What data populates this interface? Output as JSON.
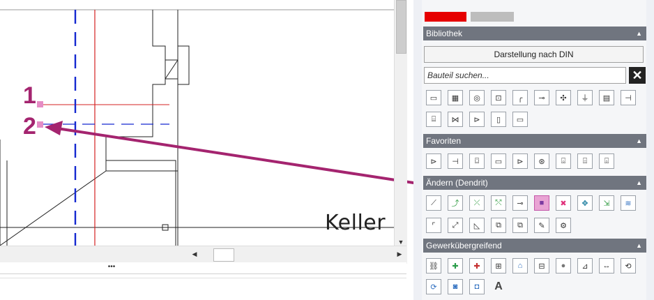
{
  "drawing": {
    "label": "Keller",
    "callouts": [
      "1",
      "2"
    ],
    "colors": {
      "red": "#d42020",
      "blue": "#1428d0",
      "arrow": "#a4246f",
      "marker": "#e58cc5"
    }
  },
  "panel": {
    "swatches": [
      "#e60000",
      "#bdbdbd"
    ],
    "sections": {
      "bibliothek": "Bibliothek",
      "favoriten": "Favoriten",
      "aendern": "Ändern (Dendrit)",
      "gewerk": "Gewerkübergreifend"
    },
    "din_button": "Darstellung nach DIN",
    "search_placeholder": "Bauteil suchen...",
    "search_close": "✕",
    "active_tool_index": 5,
    "tool_icons": {
      "bibliothek_row1": [
        "valve-box-icon",
        "hatch-icon",
        "circle-ring-icon",
        "pump-icon",
        "pipe-bend-icon",
        "circle-valve-icon",
        "star-valve-icon",
        "tank-icon",
        "radiator-icon",
        "connector-icon"
      ],
      "bibliothek_row2": [
        "boiler-icon",
        "double-valve-icon",
        "reducer-icon",
        "cylinder-icon",
        "rectangle-icon"
      ],
      "favoriten": [
        "reducer-icon",
        "connector-icon",
        "pipe-fitting-icon",
        "valve-box-icon",
        "reducer-icon",
        "gauge-icon",
        "heater-icon",
        "unit-icon",
        "unit-b-icon"
      ],
      "aendern_row1": [
        "line-edit-icon",
        "join-icon",
        "split-icon",
        "route-icon",
        "insert-icon",
        "move-object-icon",
        "delete-icon",
        "move-cross-icon",
        "adjust-icon",
        "parallel-icon"
      ],
      "aendern_row2": [
        "corner-icon",
        "extend-icon",
        "shape-icon",
        "copy-icon",
        "copy-multi-icon",
        "pencil-icon",
        "gear-pencil-icon"
      ],
      "gewerk_row1": [
        "chain-icon",
        "add-green-icon",
        "add-red-icon",
        "table-add-icon",
        "house-icon",
        "grid-icon",
        "dot-icon",
        "measure-icon",
        "dimension-icon",
        "rotate-icon"
      ],
      "gewerk_row2": [
        "reload-icon",
        "camera-icon",
        "view-icon",
        "text-icon"
      ]
    },
    "text_tool": "A"
  }
}
